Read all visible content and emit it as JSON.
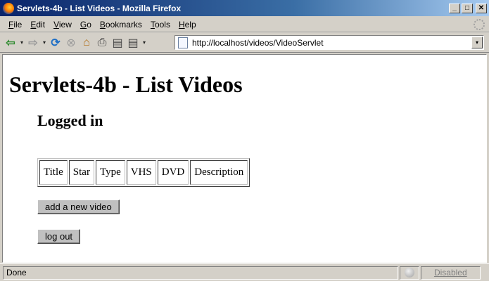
{
  "window": {
    "title": "Servlets-4b - List Videos - Mozilla Firefox",
    "controls": {
      "minimize": "_",
      "maximize": "□",
      "close": "✕"
    }
  },
  "menu": {
    "items": [
      {
        "key": "F",
        "rest": "ile"
      },
      {
        "key": "E",
        "rest": "dit"
      },
      {
        "key": "V",
        "rest": "iew"
      },
      {
        "key": "G",
        "rest": "o"
      },
      {
        "key": "B",
        "rest": "ookmarks"
      },
      {
        "key": "T",
        "rest": "ools"
      },
      {
        "key": "H",
        "rest": "elp"
      }
    ]
  },
  "toolbar": {
    "icons": {
      "back": "⇦",
      "forward": "⇨",
      "reload": "⟳",
      "stop": "⊗",
      "home": "⌂",
      "print": "⎙",
      "bookmark": "▤",
      "dropdown": "▾"
    },
    "address": "http://localhost/videos/VideoServlet"
  },
  "page": {
    "heading": "Servlets-4b - List Videos",
    "subheading": "Logged in",
    "table": {
      "columns": [
        "Title",
        "Star",
        "Type",
        "VHS",
        "DVD",
        "Description"
      ]
    },
    "add_button": "add a new video",
    "logout_button": "log out"
  },
  "status": {
    "text": "Done",
    "disabled_label": "Disabled"
  },
  "colors": {
    "titlebar_start": "#0a246a",
    "titlebar_end": "#a6caf0",
    "chrome": "#d4d0c8"
  }
}
